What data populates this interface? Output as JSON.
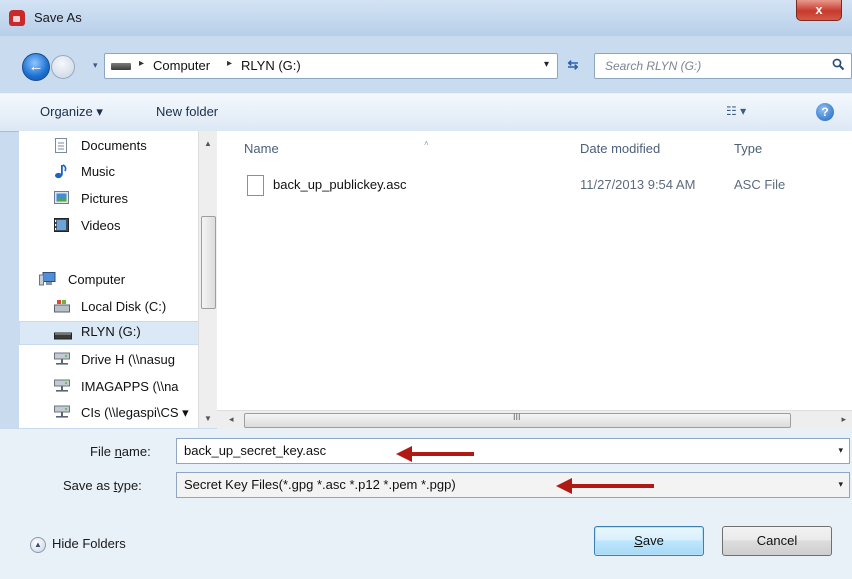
{
  "window": {
    "title": "Save As",
    "close_glyph": "x"
  },
  "nav": {
    "back_glyph": "←",
    "history_glyph": "▾"
  },
  "address": {
    "crumbs": [
      "Computer",
      "RLYN (G:)"
    ],
    "separator_glyph": "▸",
    "dropdown_glyph": "▾",
    "refresh_glyph": "⇆"
  },
  "search": {
    "placeholder": "Search RLYN (G:)",
    "icon": "search-icon"
  },
  "toolbar": {
    "organize_label": "Organize ▾",
    "new_folder_label": "New folder",
    "views_glyph": "☷ ▾",
    "help_glyph": "?"
  },
  "sidebar": {
    "items": [
      {
        "label": "Documents",
        "icon": "documents-icon"
      },
      {
        "label": "Music",
        "icon": "music-icon"
      },
      {
        "label": "Pictures",
        "icon": "pictures-icon"
      },
      {
        "label": "Videos",
        "icon": "videos-icon"
      },
      {
        "label": "Computer",
        "icon": "computer-icon"
      },
      {
        "label": "Local Disk (C:)",
        "icon": "local-disk-icon"
      },
      {
        "label": "RLYN (G:)",
        "icon": "usb-drive-icon",
        "selected": true
      },
      {
        "label": "Drive H (\\\\nasug",
        "icon": "network-drive-icon"
      },
      {
        "label": "IMAGAPPS (\\\\na",
        "icon": "network-drive-icon"
      },
      {
        "label": "CIs (\\\\legaspi\\CS ▾",
        "icon": "network-drive-icon"
      }
    ],
    "scroll_up_glyph": "▲",
    "scroll_down_glyph": "▼"
  },
  "file_list": {
    "columns": [
      "Name",
      "Date modified",
      "Type"
    ],
    "sort_glyph": "˄",
    "rows": [
      {
        "name": "back_up_publickey.asc",
        "date_modified": "11/27/2013 9:54 AM",
        "type": "ASC File"
      }
    ],
    "hscroll": {
      "left_glyph": "◂",
      "grip_glyph": "III",
      "right_glyph": "▸"
    }
  },
  "form": {
    "file_name_label_pre": "File ",
    "file_name_label_u": "n",
    "file_name_label_post": "ame:",
    "file_name_value": "back_up_secret_key.asc",
    "save_type_label_pre": "Save as ",
    "save_type_label_u": "t",
    "save_type_label_post": "ype:",
    "save_type_value": "Secret Key Files(*.gpg *.asc *.p12 *.pem *.pgp)",
    "dropdown_glyph": "▾"
  },
  "footer": {
    "hide_folders_label": "Hide Folders",
    "hide_folders_glyph": "▲",
    "save_u": "S",
    "save_rest": "ave",
    "cancel_label": "Cancel"
  },
  "colors": {
    "annotation_arrow": "#b01a14",
    "selection": "#dbe8f6",
    "window_frame": "#c9dcef"
  }
}
